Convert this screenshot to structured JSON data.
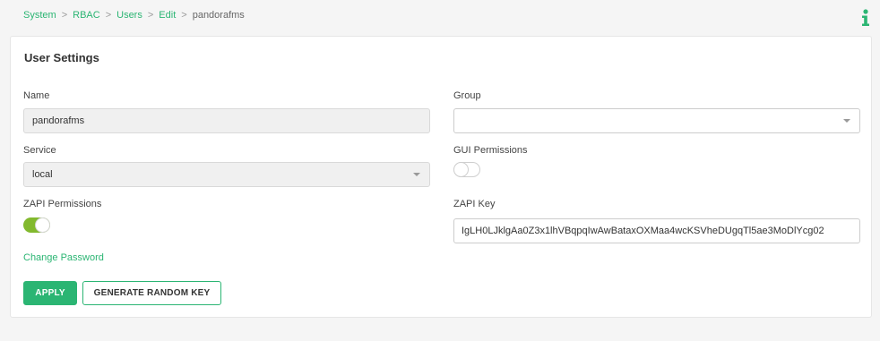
{
  "breadcrumb": {
    "items": [
      "System",
      "RBAC",
      "Users",
      "Edit"
    ],
    "current": "pandorafms",
    "separator": ">"
  },
  "card": {
    "title": "User Settings"
  },
  "form": {
    "name": {
      "label": "Name",
      "value": "pandorafms"
    },
    "group": {
      "label": "Group",
      "value": ""
    },
    "service": {
      "label": "Service",
      "value": "local"
    },
    "gui_permissions": {
      "label": "GUI Permissions",
      "enabled": false
    },
    "zapi_permissions": {
      "label": "ZAPI Permissions",
      "enabled": true
    },
    "zapi_key": {
      "label": "ZAPI Key",
      "value": "IgLH0LJklgAa0Z3x1lhVBqpqIwAwBataxOXMaa4wcKSVheDUgqTl5ae3MoDlYcg02"
    },
    "change_password": "Change Password"
  },
  "buttons": {
    "apply": "APPLY",
    "generate": "GENERATE RANDOM KEY"
  },
  "colors": {
    "accent": "#2bb573",
    "toggle_on": "#82b92e"
  },
  "icons": {
    "info": "info-icon",
    "dropdown": "chevron-down-icon"
  }
}
